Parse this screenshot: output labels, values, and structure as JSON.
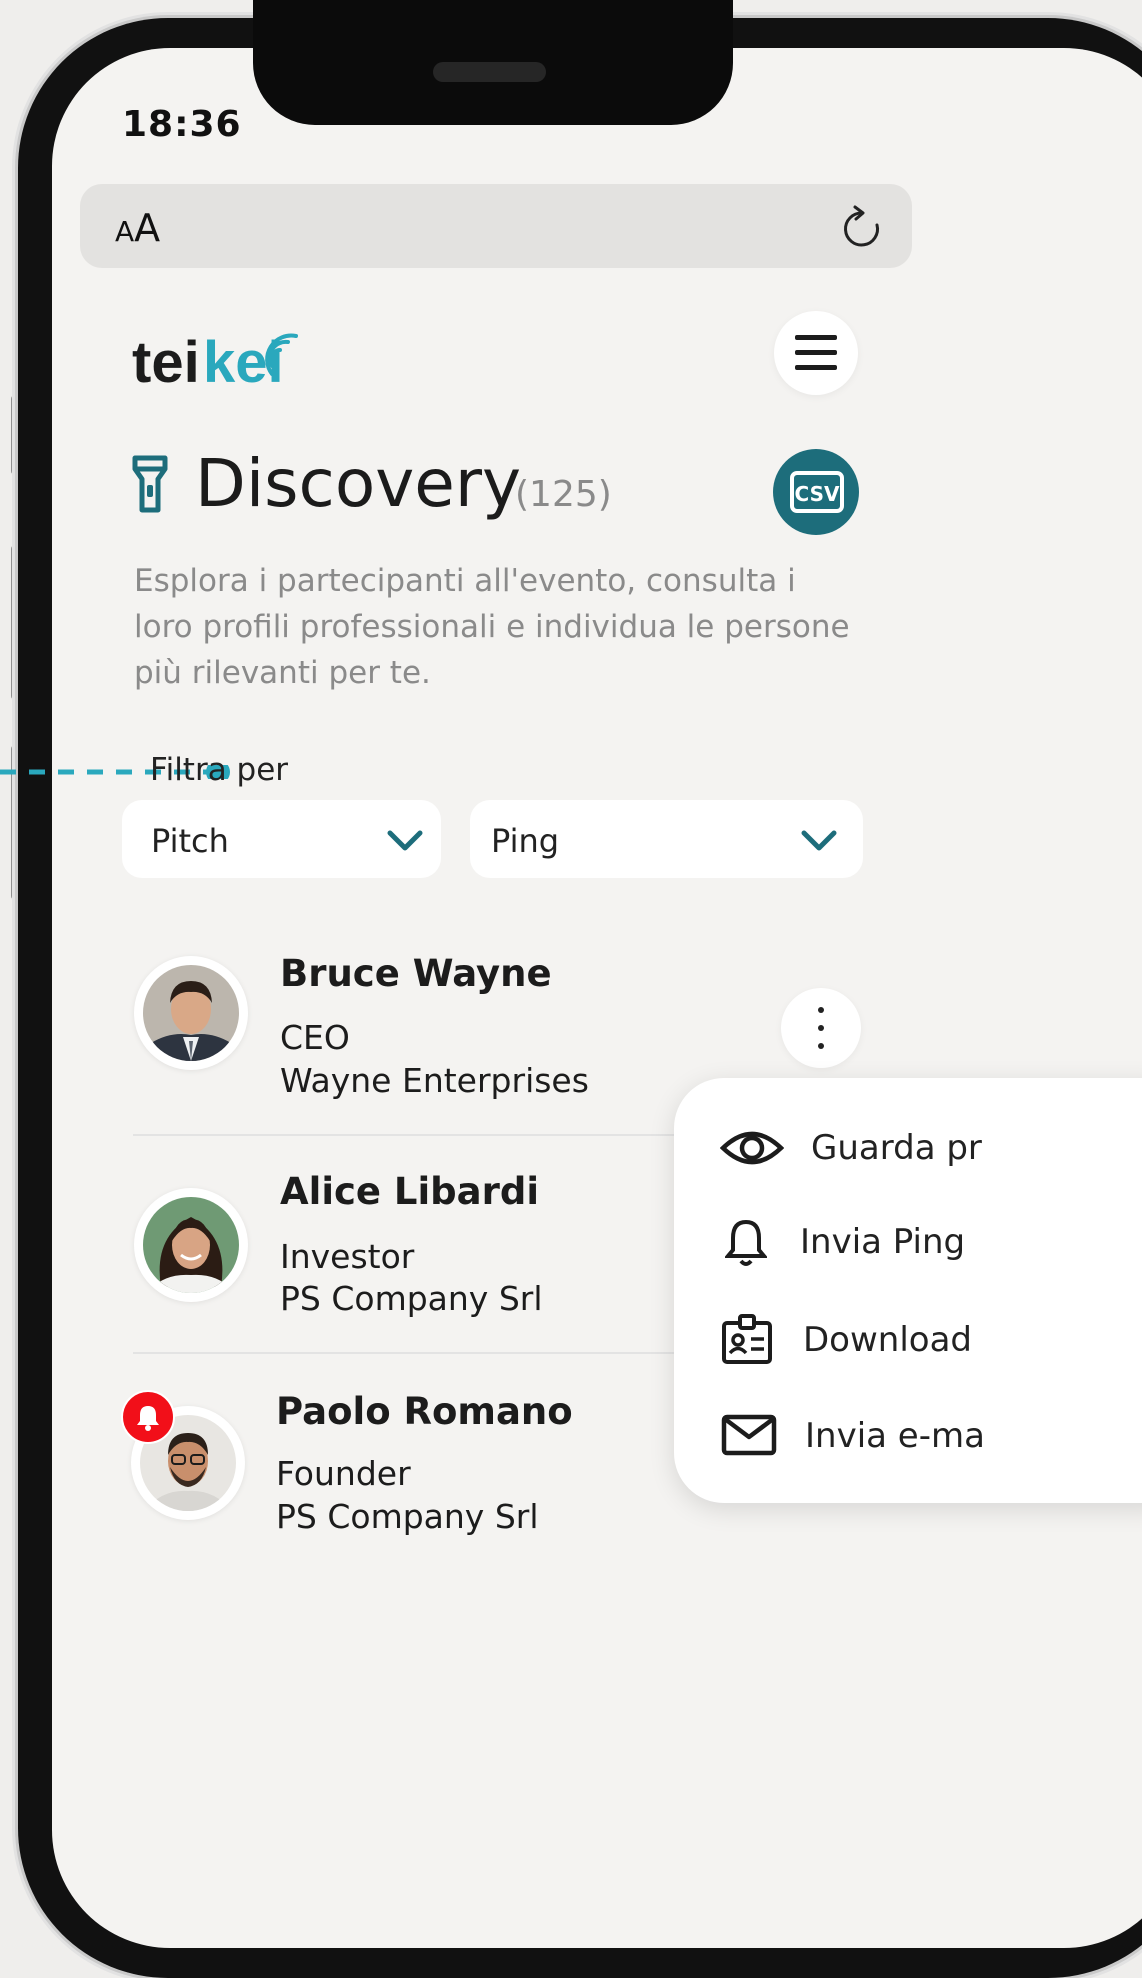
{
  "status_bar": {
    "time": "18:36"
  },
  "browser": {
    "text_size_small": "A",
    "text_size_large": "A",
    "reload_icon": "reload-icon"
  },
  "header": {
    "logo_dark": "tei",
    "logo_teal": "kei",
    "menu_icon": "hamburger-icon"
  },
  "page": {
    "title": "Discovery",
    "count": "(125)",
    "export_icon": "csv-icon",
    "description": "Esplora i partecipanti all'evento, consulta i loro profili professionali e individua le persone più rilevanti per te."
  },
  "filters": {
    "label": "Filtra per",
    "first": {
      "value": "Pitch"
    },
    "second": {
      "value": "Ping"
    }
  },
  "participants": [
    {
      "name": "Bruce Wayne",
      "role": "CEO",
      "company": "Wayne Enterprises"
    },
    {
      "name": "Alice Libardi",
      "role": "Investor",
      "company": "PS Company Srl"
    },
    {
      "name": "Paolo Romano",
      "role": "Founder",
      "company": "PS Company Srl",
      "has_notification": true
    }
  ],
  "context_menu": {
    "items": [
      {
        "label": "Guarda pr",
        "icon": "eye-icon"
      },
      {
        "label": "Invia Ping",
        "icon": "bell-icon"
      },
      {
        "label": "Download",
        "icon": "id-card-icon"
      },
      {
        "label": "Invia e-ma",
        "icon": "mail-icon"
      }
    ]
  },
  "colors": {
    "brand_teal": "#1d6d7b",
    "accent_cyan": "#2aa8bd",
    "alert_red": "#f20f19"
  }
}
